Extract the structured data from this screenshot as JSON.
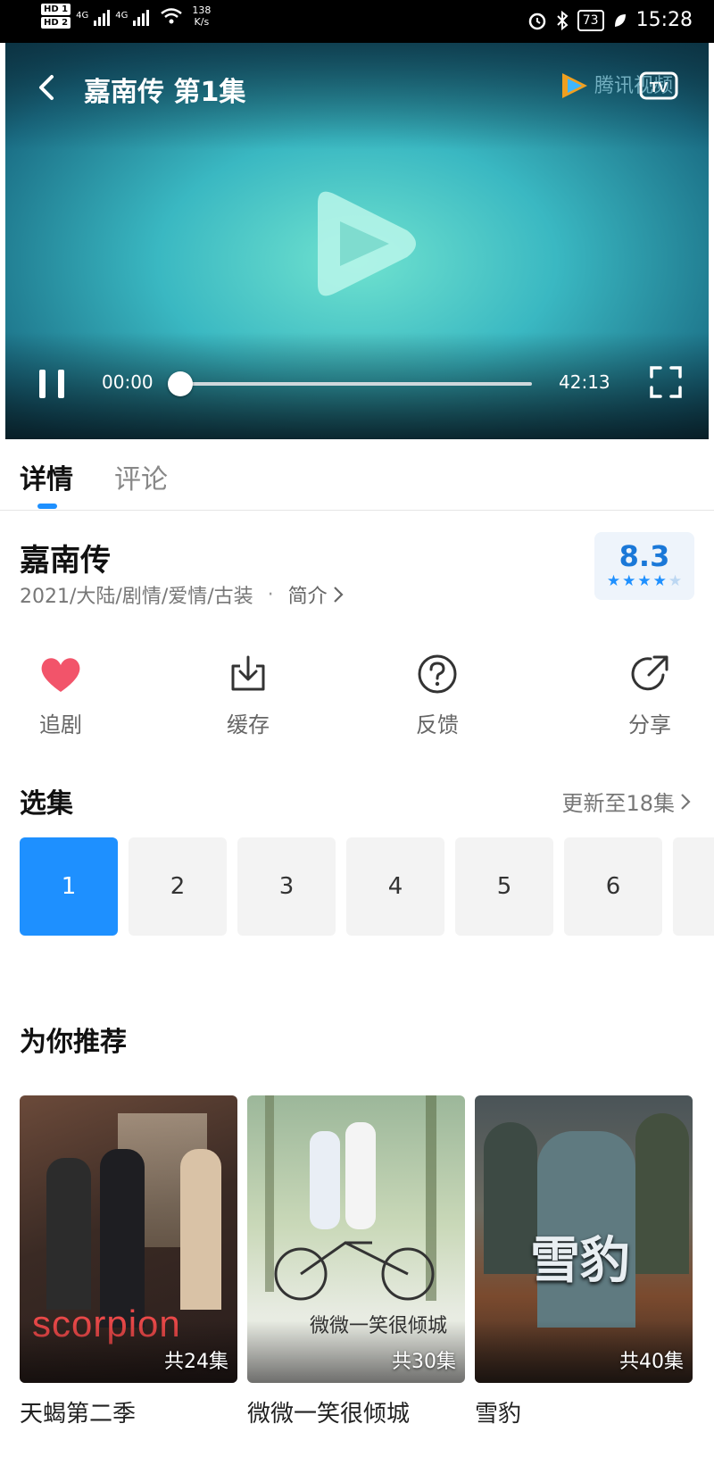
{
  "status_bar": {
    "hd1": "HD 1",
    "hd2": "HD 2",
    "net_sig1": "4G",
    "net_sig2": "4G",
    "speed": "138",
    "speed_unit": "K/s",
    "battery": "73",
    "time": "15:28"
  },
  "player": {
    "title": "嘉南传 第1集",
    "logo_text": "腾讯视频",
    "current_time": "00:00",
    "duration": "42:13",
    "progress": 0
  },
  "tabs": [
    "详情",
    "评论"
  ],
  "show": {
    "title": "嘉南传",
    "meta": "2021/大陆/剧情/爱情/古装",
    "intro": "简介",
    "score": "8.3",
    "stars_filled": 4,
    "stars_total": 5
  },
  "actions": [
    {
      "label": "追剧",
      "icon": "heart-icon"
    },
    {
      "label": "缓存",
      "icon": "download-icon"
    },
    {
      "label": "反馈",
      "icon": "question-icon"
    },
    {
      "label": "分享",
      "icon": "share-icon"
    }
  ],
  "episodes": {
    "title": "选集",
    "more": "更新至18集",
    "items": [
      "1",
      "2",
      "3",
      "4",
      "5",
      "6"
    ],
    "selected": "1"
  },
  "recommend": {
    "title": "为你推荐",
    "items": [
      {
        "name": "天蝎第二季",
        "badge": "共24集",
        "poster_text": "scorpion"
      },
      {
        "name": "微微一笑很倾城",
        "badge": "共30集",
        "poster_text": "微微一笑很倾城"
      },
      {
        "name": "雪豹",
        "badge": "共40集",
        "poster_text": "雪豹"
      }
    ]
  },
  "colors": {
    "accent": "#1e90ff",
    "heart": "#f2546a"
  }
}
